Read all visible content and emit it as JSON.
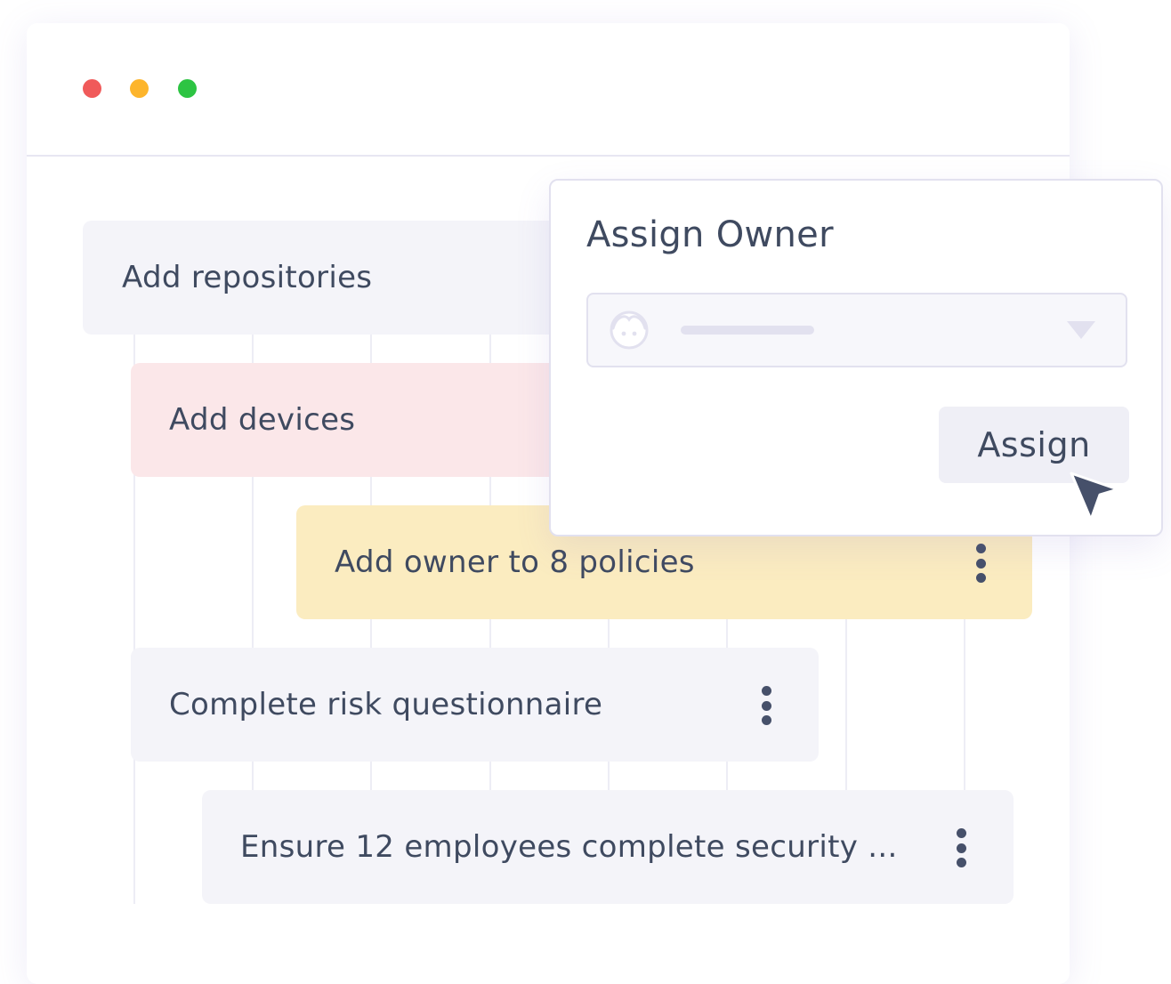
{
  "window": {
    "controls": [
      {
        "name": "close",
        "color": "#f05a5a"
      },
      {
        "name": "minimize",
        "color": "#fdb52c"
      },
      {
        "name": "maximize",
        "color": "#2dc443"
      }
    ]
  },
  "tasks": [
    {
      "label": "Add repositories",
      "background": "#f4f4f9"
    },
    {
      "label": "Add devices",
      "background": "#fbe7e9"
    },
    {
      "label": "Add owner to 8 policies",
      "background": "#fbecc0"
    },
    {
      "label": "Complete risk questionnaire",
      "background": "#f4f4f9"
    },
    {
      "label": "Ensure 12 employees complete security ...",
      "background": "#f4f4f9"
    }
  ],
  "popup": {
    "title": "Assign Owner",
    "owner_select": {
      "icon": "avatar-icon",
      "chevron": "chevron-down-icon"
    },
    "assign_label": "Assign"
  },
  "colors": {
    "text": "#3f4a60",
    "icon_dots": "#46506a",
    "border": "#e2e1ef",
    "cursor": "#46506a"
  }
}
